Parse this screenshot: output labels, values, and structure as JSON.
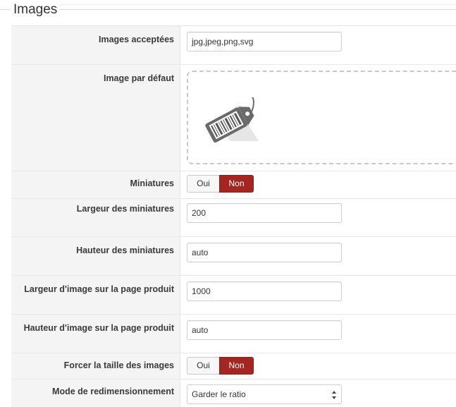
{
  "section": {
    "legend": "Images"
  },
  "fields": {
    "accepted_images": {
      "label": "Images acceptées",
      "value": "jpg,jpeg,png,svg"
    },
    "default_image": {
      "label": "Image par défaut",
      "icon": "price-tag-icon"
    },
    "thumbnails": {
      "label": "Miniatures",
      "options": [
        "Oui",
        "Non"
      ],
      "selected": "Non"
    },
    "thumb_width": {
      "label": "Largeur des miniatures",
      "value": "200"
    },
    "thumb_height": {
      "label": "Hauteur des miniatures",
      "value": "auto"
    },
    "product_image_width": {
      "label": "Largeur d'image sur la page produit",
      "value": "1000"
    },
    "product_image_height": {
      "label": "Hauteur d'image sur la page produit",
      "value": "auto"
    },
    "force_size": {
      "label": "Forcer la taille des images",
      "options": [
        "Oui",
        "Non"
      ],
      "selected": "Non"
    },
    "resize_mode": {
      "label": "Mode de redimensionnement",
      "value": "Garder le ratio"
    }
  },
  "colors": {
    "toggle_active": "#a32720",
    "label_bg": "#f4f4f4"
  }
}
